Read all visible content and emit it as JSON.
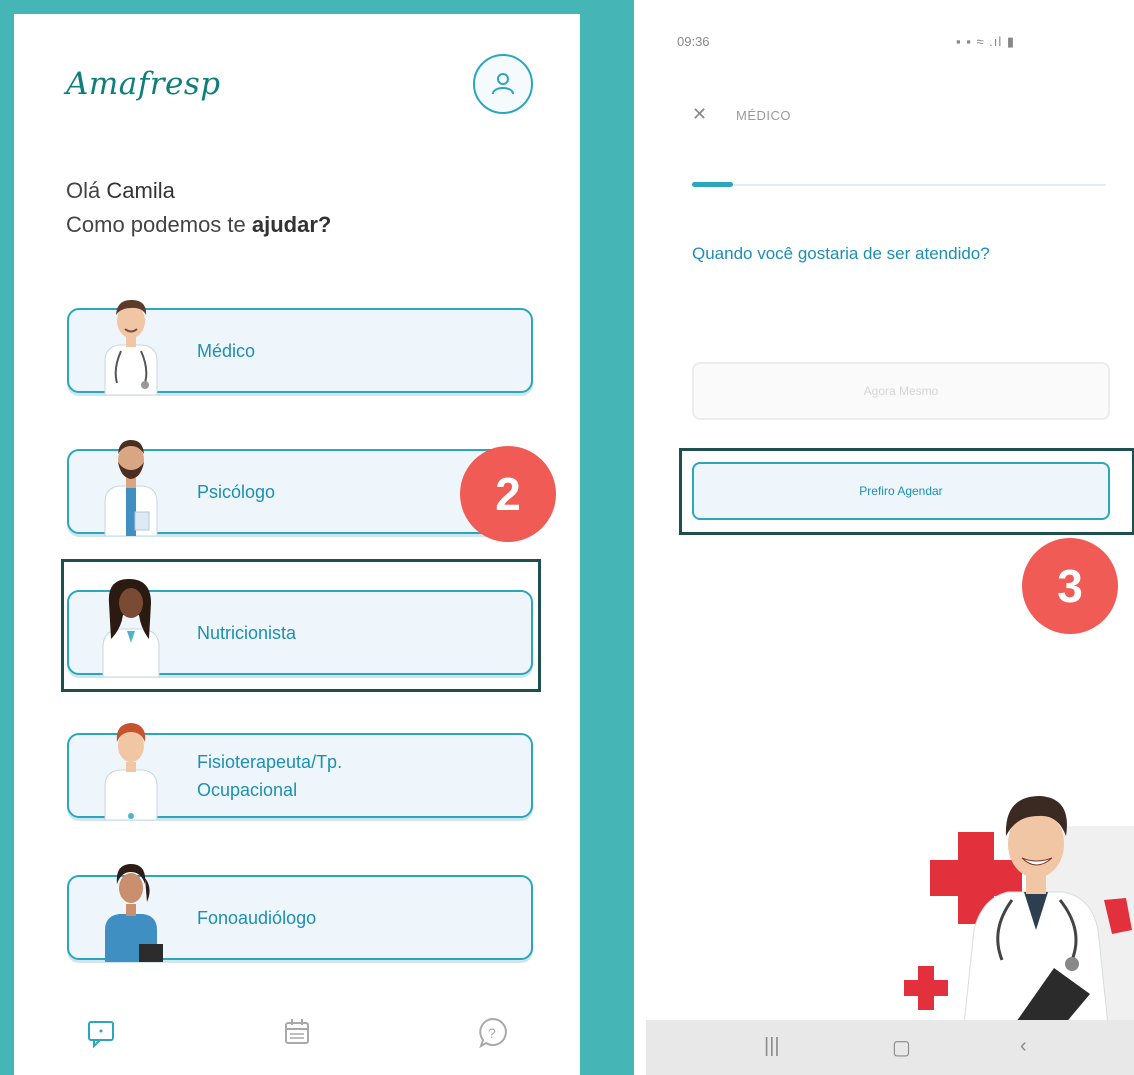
{
  "left": {
    "logo": "Amafresp",
    "greeting_prefix": "Olá",
    "greeting_name": "Camila",
    "question_prefix": "Como podemos te",
    "question_bold": "ajudar?",
    "services": [
      {
        "label": "Médico"
      },
      {
        "label": "Psicólogo"
      },
      {
        "label": "Nutricionista"
      },
      {
        "label": "Fisioterapeuta/Tp.",
        "label2": "Ocupacional"
      },
      {
        "label": "Fonoaudiólogo"
      }
    ],
    "nav_icons": [
      "chat-icon",
      "calendar-icon",
      "help-icon"
    ]
  },
  "right": {
    "status_time": "09:36",
    "modal_title": "MÉDICO",
    "question": "Quando você gostaria de ser atendido?",
    "progress": 0.1,
    "option_now": "Agora Mesmo",
    "option_schedule": "Prefiro Agendar"
  },
  "badges": {
    "step2": "2",
    "step3": "3"
  },
  "colors": {
    "accent": "#2ba6bf",
    "background": "#45b5b6",
    "badge": "#f05b55",
    "highlight": "#1c4f4e"
  }
}
